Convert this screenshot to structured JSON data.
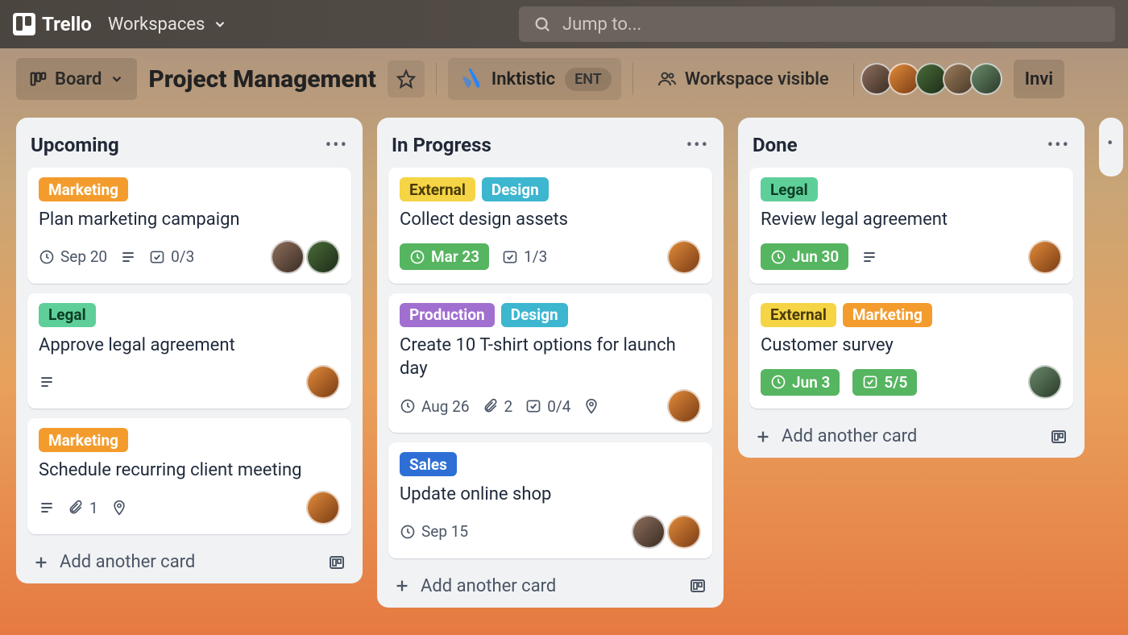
{
  "nav": {
    "app_name": "Trello",
    "workspaces_label": "Workspaces",
    "search_placeholder": "Jump to..."
  },
  "header": {
    "view_button": "Board",
    "board_title": "Project Management",
    "workspace_name": "Inktistic",
    "workspace_tier": "ENT",
    "visibility_label": "Workspace visible",
    "invite_label": "Invi"
  },
  "lists": [
    {
      "title": "Upcoming",
      "cards": [
        {
          "labels": [
            {
              "text": "Marketing",
              "color": "orange"
            }
          ],
          "title": "Plan marketing campaign",
          "badges": [
            {
              "icon": "clock",
              "text": "Sep 20"
            },
            {
              "icon": "description"
            },
            {
              "icon": "checklist",
              "text": "0/3"
            }
          ],
          "members": [
            "a",
            "c"
          ]
        },
        {
          "labels": [
            {
              "text": "Legal",
              "color": "green"
            }
          ],
          "title": "Approve legal agreement",
          "badges": [
            {
              "icon": "description"
            }
          ],
          "members": [
            "b"
          ]
        },
        {
          "labels": [
            {
              "text": "Marketing",
              "color": "orange"
            }
          ],
          "title": "Schedule recurring client meeting",
          "badges": [
            {
              "icon": "description"
            },
            {
              "icon": "attachment",
              "text": "1"
            },
            {
              "icon": "location"
            }
          ],
          "members": [
            "b"
          ]
        }
      ],
      "add_card_label": "Add another card"
    },
    {
      "title": "In Progress",
      "cards": [
        {
          "labels": [
            {
              "text": "External",
              "color": "yellow"
            },
            {
              "text": "Design",
              "color": "blue"
            }
          ],
          "title": "Collect design assets",
          "badges": [
            {
              "icon": "clock",
              "text": "Mar 23",
              "pill": true
            },
            {
              "icon": "checklist",
              "text": "1/3"
            }
          ],
          "members": [
            "b"
          ]
        },
        {
          "labels": [
            {
              "text": "Production",
              "color": "purple"
            },
            {
              "text": "Design",
              "color": "blue"
            }
          ],
          "title": "Create 10 T-shirt options for launch day",
          "badges": [
            {
              "icon": "clock",
              "text": "Aug 26"
            },
            {
              "icon": "attachment",
              "text": "2"
            },
            {
              "icon": "checklist",
              "text": "0/4"
            },
            {
              "icon": "location"
            }
          ],
          "members": [
            "b"
          ]
        },
        {
          "labels": [
            {
              "text": "Sales",
              "color": "navy"
            }
          ],
          "title": "Update online shop",
          "badges": [
            {
              "icon": "clock",
              "text": "Sep 15"
            }
          ],
          "members": [
            "a",
            "b"
          ]
        }
      ],
      "add_card_label": "Add another card"
    },
    {
      "title": "Done",
      "cards": [
        {
          "labels": [
            {
              "text": "Legal",
              "color": "green"
            }
          ],
          "title": "Review legal agreement",
          "badges": [
            {
              "icon": "clock",
              "text": "Jun 30",
              "pill": true
            },
            {
              "icon": "description"
            }
          ],
          "members": [
            "b"
          ]
        },
        {
          "labels": [
            {
              "text": "External",
              "color": "yellow"
            },
            {
              "text": "Marketing",
              "color": "orange"
            }
          ],
          "title": "Customer survey",
          "badges": [
            {
              "icon": "clock",
              "text": "Jun 3",
              "pill": true
            },
            {
              "icon": "checklist",
              "text": "5/5",
              "pill": true
            }
          ],
          "members": [
            "e"
          ]
        }
      ],
      "add_card_label": "Add another card"
    }
  ],
  "avatar_colors": [
    "a",
    "b",
    "c",
    "d",
    "e"
  ]
}
